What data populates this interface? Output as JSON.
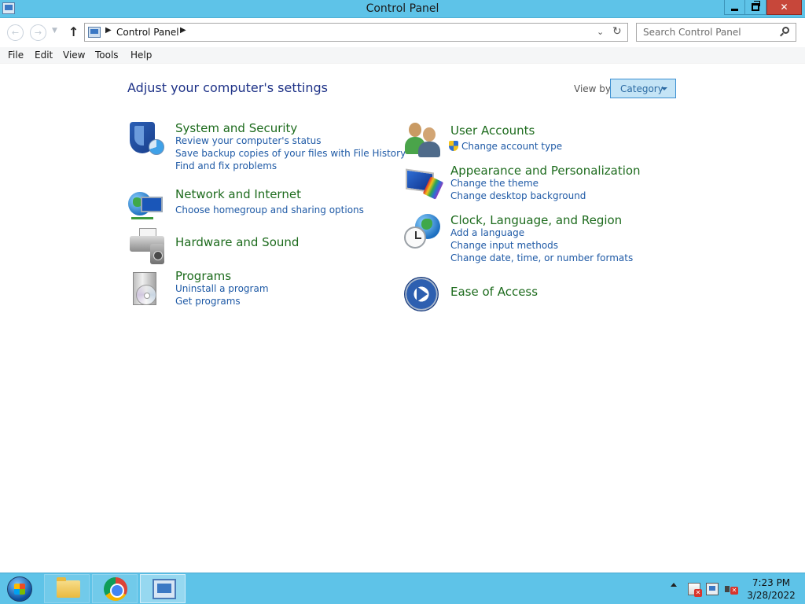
{
  "window": {
    "title": "Control Panel",
    "icons": {
      "app": "control-panel-icon",
      "minimize": "minimize-icon",
      "maximize": "restore-icon",
      "close": "close-icon"
    }
  },
  "nav": {
    "breadcrumb": "Control Panel",
    "search_placeholder": "Search Control Panel"
  },
  "menu": [
    "File",
    "Edit",
    "View",
    "Tools",
    "Help"
  ],
  "content": {
    "heading": "Adjust your computer's settings",
    "view_by_label": "View by:",
    "view_by_value": "Category",
    "left": [
      {
        "title": "System and Security",
        "icon": "shield-icon",
        "links": [
          "Review your computer's status",
          "Save backup copies of your files with File History",
          "Find and fix problems"
        ]
      },
      {
        "title": "Network and Internet",
        "icon": "network-icon",
        "links": [
          "Choose homegroup and sharing options"
        ]
      },
      {
        "title": "Hardware and Sound",
        "icon": "printer-icon",
        "links": []
      },
      {
        "title": "Programs",
        "icon": "programs-icon",
        "links": [
          "Uninstall a program",
          "Get programs"
        ]
      }
    ],
    "right": [
      {
        "title": "User Accounts",
        "icon": "users-icon",
        "links": [
          "Change account type"
        ]
      },
      {
        "title": "Appearance and Personalization",
        "icon": "appearance-icon",
        "links": [
          "Change the theme",
          "Change desktop background"
        ]
      },
      {
        "title": "Clock, Language, and Region",
        "icon": "clock-globe-icon",
        "links": [
          "Add a language",
          "Change input methods",
          "Change date, time, or number formats"
        ]
      },
      {
        "title": "Ease of Access",
        "icon": "ease-of-access-icon",
        "links": []
      }
    ]
  },
  "taskbar": {
    "time": "7:23 PM",
    "date": "3/28/2022",
    "pinned": [
      "file-explorer-icon",
      "chrome-icon",
      "control-panel-icon"
    ]
  },
  "colors": {
    "title_bar": "#5ec3e8",
    "heading": "#1e3287",
    "category_title": "#1d6b1d",
    "link": "#1f5aa6",
    "close_button": "#c7473a"
  }
}
